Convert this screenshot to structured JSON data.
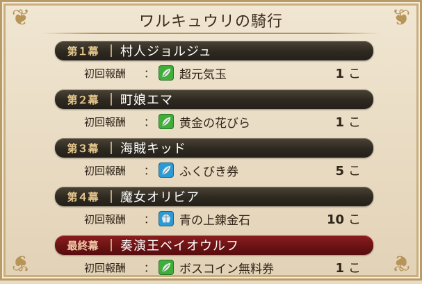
{
  "title": "ワルキュウリの騎行",
  "reward_label": "初回報酬",
  "colon": "：",
  "chapters": [
    {
      "label": "第１幕",
      "name": "村人ジョルジュ",
      "item": "超元気玉",
      "count": "1",
      "unit": "こ",
      "icon": "green-leaf-icon",
      "icon_color": "#3fae3b"
    },
    {
      "label": "第２幕",
      "name": "町娘エマ",
      "item": "黄金の花びら",
      "count": "1",
      "unit": "こ",
      "icon": "green-leaf-icon",
      "icon_color": "#3fae3b"
    },
    {
      "label": "第３幕",
      "name": "海賊キッド",
      "item": "ふくびき券",
      "count": "5",
      "unit": "こ",
      "icon": "blue-leaf-icon",
      "icon_color": "#2a9bd6"
    },
    {
      "label": "第４幕",
      "name": "魔女オリビア",
      "item": "青の上錬金石",
      "count": "10",
      "unit": "こ",
      "icon": "blue-ore-icon",
      "icon_color": "#2a9bd6"
    },
    {
      "label": "最終幕",
      "name": "奏演王ベイオウルフ",
      "item": "ボスコイン無料券",
      "count": "1",
      "unit": "こ",
      "icon": "green-leaf-icon",
      "icon_color": "#3fae3b",
      "final": true
    }
  ]
}
